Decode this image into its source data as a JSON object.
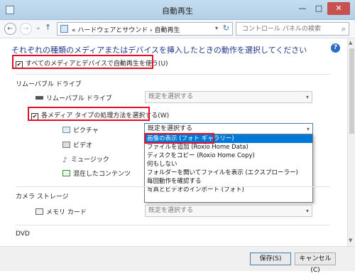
{
  "window": {
    "title": "自動再生",
    "controls": {
      "minimize": "—",
      "maximize": "□",
      "close": "✕"
    }
  },
  "nav": {
    "back_glyph": "←",
    "forward_glyph": "→",
    "recent_glyph": "⌄",
    "up_glyph": "↑",
    "breadcrumb": "« ハードウェアとサウンド › 自動再生",
    "dropdown_glyph": "▾",
    "refresh_glyph": "↻",
    "search_placeholder": "コントロール パネルの検索"
  },
  "heading": "それぞれの種類のメディアまたはデバイスを挿入したときの動作を選択してください",
  "help_glyph": "?",
  "autoplay_all": {
    "label": "すべてのメディアとデバイスで自動再生を使う(U)",
    "checked": true
  },
  "removable_section": "リムーバブル ドライブ",
  "removable_drive": {
    "label": "リムーバブル ドライブ",
    "value": "既定を選択する"
  },
  "per_media": {
    "label": "各メディア タイプの処理方法を選択する(W)",
    "checked": true
  },
  "media_rows": [
    {
      "label": "ピクチャ",
      "value": "既定を選択する"
    },
    {
      "label": "ビデオ"
    },
    {
      "label": "ミュージック"
    },
    {
      "label": "混在したコンテンツ"
    }
  ],
  "dropdown_options": [
    "画像の表示 (フォト ギャラリー)",
    "ファイルを追加 (Roxio Home Data)",
    "ディスクをコピー (Roxio Home Copy)",
    "何もしない",
    "フォルダーを開いてファイルを表示 (エクスプローラー)",
    "毎回動作を確認する",
    "写真とビデオのインポート (フォト)"
  ],
  "selected_option_index": 0,
  "camera_section": "カメラ ストレージ",
  "memory_card": {
    "label": "メモリ カード",
    "value": "既定を選択する"
  },
  "dvd_section": "DVD",
  "checkmark": "✔",
  "combo_arrow": "▾",
  "music_glyph": "♪",
  "scroll_up": "▲",
  "scroll_down": "▼",
  "buttons": {
    "save": "保存(S)",
    "cancel": "キャンセル(C)"
  },
  "colors": {
    "highlight": "#e0102a",
    "selection": "#0078d7",
    "heading": "#1e3a8a"
  }
}
